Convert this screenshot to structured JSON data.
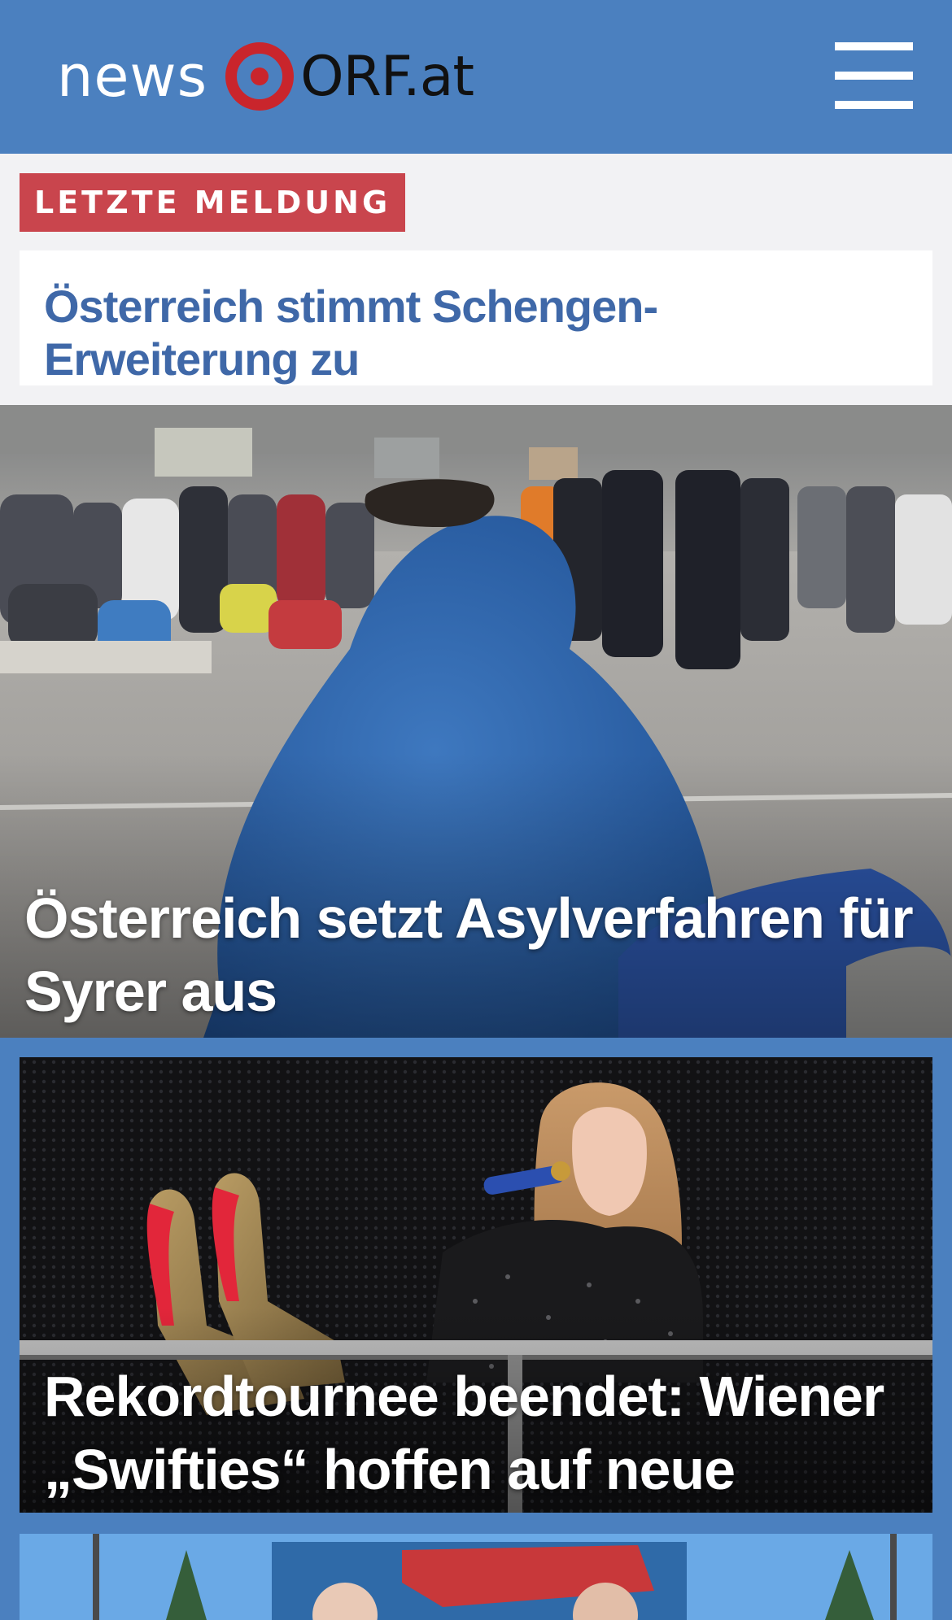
{
  "header": {
    "logo_news": "news",
    "logo_orf": "ORF.at",
    "menu_icon": "hamburger-menu-icon"
  },
  "breaking": {
    "badge": "LETZTE MELDUNG",
    "headline": "Österreich stimmt Schengen-Erweiterung zu"
  },
  "articles": [
    {
      "title": "Österreich setzt Asylverfahren für Syrer aus",
      "image": "person-in-blue-blanket-at-refugee-camp-photo"
    },
    {
      "title": "Rekordtournee beendet: Wiener „Swifties“ hoffen auf neue Chance",
      "image": "singer-on-stage-with-microphone-photo"
    },
    {
      "title": "",
      "image": "billboard-with-portraits-photo"
    }
  ],
  "colors": {
    "header_bg": "#4b80bf",
    "badge_bg": "#c9454d",
    "link": "#3f68a8",
    "logo_red": "#c9252c"
  }
}
